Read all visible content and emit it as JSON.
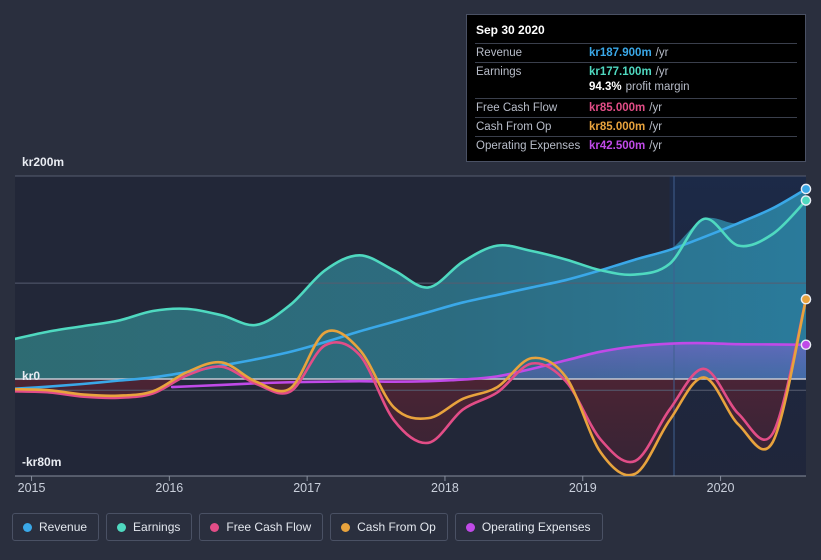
{
  "tooltip": {
    "title": "Sep 30 2020",
    "rows": [
      {
        "label": "Revenue",
        "value": "kr187.900m",
        "unit": "/yr",
        "color": "#3aa8e8"
      },
      {
        "label": "Earnings",
        "value": "kr177.100m",
        "unit": "/yr",
        "color": "#4fd9c0"
      },
      {
        "label": "",
        "value": "94.3%",
        "unit": "profit margin",
        "color": "#ffffff"
      },
      {
        "label": "Free Cash Flow",
        "value": "kr85.000m",
        "unit": "/yr",
        "color": "#e24d87"
      },
      {
        "label": "Cash From Op",
        "value": "kr85.000m",
        "unit": "/yr",
        "color": "#e8a33d"
      },
      {
        "label": "Operating Expenses",
        "value": "kr42.500m",
        "unit": "/yr",
        "color": "#c04ae8"
      }
    ]
  },
  "legend": {
    "items": [
      {
        "label": "Revenue",
        "color": "#3aa8e8"
      },
      {
        "label": "Earnings",
        "color": "#4fd9c0"
      },
      {
        "label": "Free Cash Flow",
        "color": "#e24d87"
      },
      {
        "label": "Cash From Op",
        "color": "#e8a33d"
      },
      {
        "label": "Operating Expenses",
        "color": "#c04ae8"
      }
    ]
  },
  "chart_data": {
    "type": "area",
    "title": "",
    "xlabel": "",
    "ylabel": "",
    "currency_prefix": "kr",
    "unit_suffix": "m",
    "ylim": [
      -80,
      200
    ],
    "y_ticks": [
      200,
      100,
      0,
      -80
    ],
    "y_tick_labels": [
      "kr200m",
      "",
      "kr0",
      "-kr80m"
    ],
    "grid": true,
    "legend_position": "bottom",
    "x_ticks": [
      2015,
      2016,
      2017,
      2018,
      2019,
      2020
    ],
    "x_tick_labels": [
      "2015",
      "2016",
      "2017",
      "2018",
      "2019",
      "2020"
    ],
    "xlim": [
      2014.88,
      2020.62
    ],
    "forecast_divider_x": 2019.63,
    "series": [
      {
        "name": "Revenue",
        "color": "#3aa8e8",
        "x": [
          2014.88,
          2015.13,
          2015.38,
          2015.63,
          2015.88,
          2016.13,
          2016.38,
          2016.63,
          2016.88,
          2017.13,
          2017.38,
          2017.63,
          2017.88,
          2018.13,
          2018.38,
          2018.63,
          2018.88,
          2019.13,
          2019.38,
          2019.63,
          2019.88,
          2020.13,
          2020.38,
          2020.62
        ],
        "values": [
          1.5,
          3.5,
          6.0,
          9.0,
          12.0,
          17.0,
          23.0,
          29.0,
          36.0,
          45.0,
          55.0,
          64.0,
          73.0,
          82.0,
          89.0,
          96.0,
          103.0,
          112.0,
          122.0,
          131.0,
          143.0,
          156.0,
          170.0,
          187.9
        ]
      },
      {
        "name": "Earnings",
        "color": "#4fd9c0",
        "x": [
          2014.88,
          2015.13,
          2015.38,
          2015.63,
          2015.88,
          2016.13,
          2016.38,
          2016.63,
          2016.88,
          2017.13,
          2017.38,
          2017.63,
          2017.88,
          2018.13,
          2018.38,
          2018.63,
          2018.88,
          2019.13,
          2019.38,
          2019.63,
          2019.88,
          2020.13,
          2020.38,
          2020.62
        ],
        "values": [
          48.0,
          55.0,
          60.0,
          65.0,
          74.0,
          76.0,
          70.0,
          61.0,
          80.0,
          112.0,
          126.0,
          112.0,
          96.0,
          120.0,
          135.0,
          130.0,
          122.0,
          112.0,
          108.0,
          118.0,
          160.0,
          135.0,
          146.0,
          177.1
        ]
      },
      {
        "name": "Free Cash Flow",
        "color": "#e24d87",
        "x": [
          2014.88,
          2015.13,
          2015.38,
          2015.63,
          2015.88,
          2016.13,
          2016.38,
          2016.63,
          2016.88,
          2017.13,
          2017.38,
          2017.63,
          2017.88,
          2018.13,
          2018.38,
          2018.63,
          2018.88,
          2019.13,
          2019.38,
          2019.63,
          2019.88,
          2020.13,
          2020.38,
          2020.62
        ],
        "values": [
          -1.0,
          -2.0,
          -6.0,
          -7.0,
          -3.0,
          14.0,
          22.0,
          6.0,
          -1.0,
          42.0,
          33.0,
          -28.0,
          -49.0,
          -18.0,
          -2.0,
          25.0,
          8.0,
          -46.0,
          -66.0,
          -18.0,
          20.0,
          -22.0,
          -40.0,
          85.0
        ]
      },
      {
        "name": "Cash From Op",
        "color": "#e8a33d",
        "x": [
          2014.88,
          2015.13,
          2015.38,
          2015.63,
          2015.88,
          2016.13,
          2016.38,
          2016.63,
          2016.88,
          2017.13,
          2017.38,
          2017.63,
          2017.88,
          2018.13,
          2018.38,
          2018.63,
          2018.88,
          2019.13,
          2019.38,
          2019.63,
          2019.88,
          2020.13,
          2020.38,
          2020.62
        ],
        "values": [
          1.0,
          0.0,
          -4.0,
          -5.0,
          -1.0,
          17.0,
          26.0,
          8.0,
          2.0,
          54.0,
          38.0,
          -16.0,
          -26.0,
          -8.0,
          3.0,
          30.0,
          12.0,
          -58.0,
          -78.0,
          -28.0,
          12.0,
          -32.0,
          -48.0,
          85.0
        ]
      },
      {
        "name": "Operating Expenses",
        "color": "#c04ae8",
        "x": [
          2016.02,
          2016.38,
          2016.63,
          2016.88,
          2017.13,
          2017.38,
          2017.63,
          2017.88,
          2018.13,
          2018.38,
          2018.63,
          2018.88,
          2019.13,
          2019.38,
          2019.63,
          2019.88,
          2020.13,
          2020.38,
          2020.62
        ],
        "values": [
          3.0,
          5.0,
          6.5,
          7.5,
          8.0,
          8.5,
          8.0,
          8.5,
          10.0,
          13.0,
          20.0,
          28.0,
          36.0,
          41.0,
          43.5,
          44.0,
          43.0,
          42.8,
          42.5
        ]
      }
    ]
  }
}
